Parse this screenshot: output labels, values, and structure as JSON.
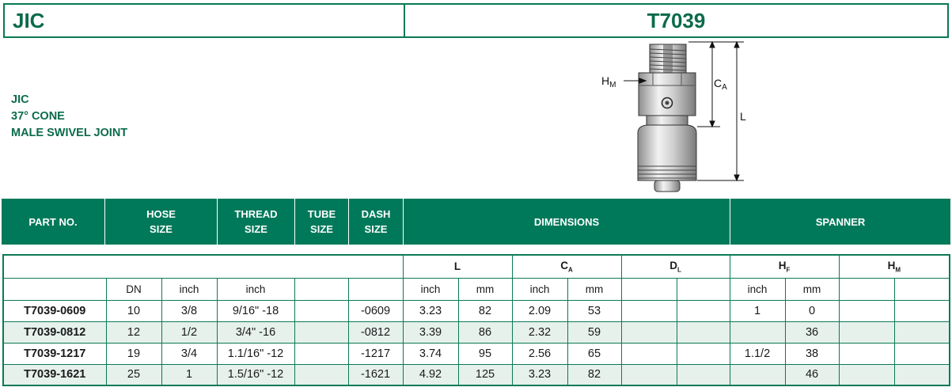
{
  "header": {
    "left_title": "JIC",
    "right_title": "T7039"
  },
  "description": {
    "line1": "JIC",
    "line2": "37° CONE",
    "line3": "MALE SWIVEL JOINT"
  },
  "drawing": {
    "hm_main": "H",
    "hm_sub": "M",
    "ca_main": "C",
    "ca_sub": "A",
    "l_label": "L"
  },
  "columns": {
    "part_no": "PART NO.",
    "hose_size_1": "HOSE",
    "hose_size_2": "SIZE",
    "thread_size_1": "THREAD",
    "thread_size_2": "SIZE",
    "tube_size_1": "TUBE",
    "tube_size_2": "SIZE",
    "dash_size_1": "DASH",
    "dash_size_2": "SIZE",
    "dimensions": "DIMENSIONS",
    "spanner": "SPANNER"
  },
  "subheaders": {
    "l": "L",
    "ca_main": "C",
    "ca_sub": "A",
    "dl_main": "D",
    "dl_sub": "L",
    "hf_main": "H",
    "hf_sub": "F",
    "hm_main": "H",
    "hm_sub": "M"
  },
  "units": {
    "dn": "DN",
    "hose_inch": "inch",
    "thread_inch": "inch",
    "l_inch": "inch",
    "l_mm": "mm",
    "ca_inch": "inch",
    "ca_mm": "mm",
    "hf_inch": "inch",
    "hf_mm": "mm"
  },
  "rows": [
    {
      "part": "T7039-0609",
      "dn": "10",
      "inch": "3/8",
      "thread": "9/16\" -18",
      "tube": "",
      "dash": "-0609",
      "l_in": "3.23",
      "l_mm": "82",
      "ca_in": "2.09",
      "ca_mm": "53",
      "dl_in": "",
      "dl_mm": "",
      "hf_in": "1",
      "hf_mm": "0",
      "hm_in": "",
      "hm_mm": ""
    },
    {
      "part": "T7039-0812",
      "dn": "12",
      "inch": "1/2",
      "thread": "3/4\" -16",
      "tube": "",
      "dash": "-0812",
      "l_in": "3.39",
      "l_mm": "86",
      "ca_in": "2.32",
      "ca_mm": "59",
      "dl_in": "",
      "dl_mm": "",
      "hf_in": "",
      "hf_mm": "36",
      "hm_in": "",
      "hm_mm": ""
    },
    {
      "part": "T7039-1217",
      "dn": "19",
      "inch": "3/4",
      "thread": "1.1/16\" -12",
      "tube": "",
      "dash": "-1217",
      "l_in": "3.74",
      "l_mm": "95",
      "ca_in": "2.56",
      "ca_mm": "65",
      "dl_in": "",
      "dl_mm": "",
      "hf_in": "1.1/2",
      "hf_mm": "38",
      "hm_in": "",
      "hm_mm": ""
    },
    {
      "part": "T7039-1621",
      "dn": "25",
      "inch": "1",
      "thread": "1.5/16\" -12",
      "tube": "",
      "dash": "-1621",
      "l_in": "4.92",
      "l_mm": "125",
      "ca_in": "3.23",
      "ca_mm": "82",
      "dl_in": "",
      "dl_mm": "",
      "hf_in": "",
      "hf_mm": "46",
      "hm_in": "",
      "hm_mm": ""
    }
  ],
  "colors": {
    "brand_green": "#00795a",
    "title_green": "#0b6b4a",
    "row_alt": "#e6f1ec"
  }
}
